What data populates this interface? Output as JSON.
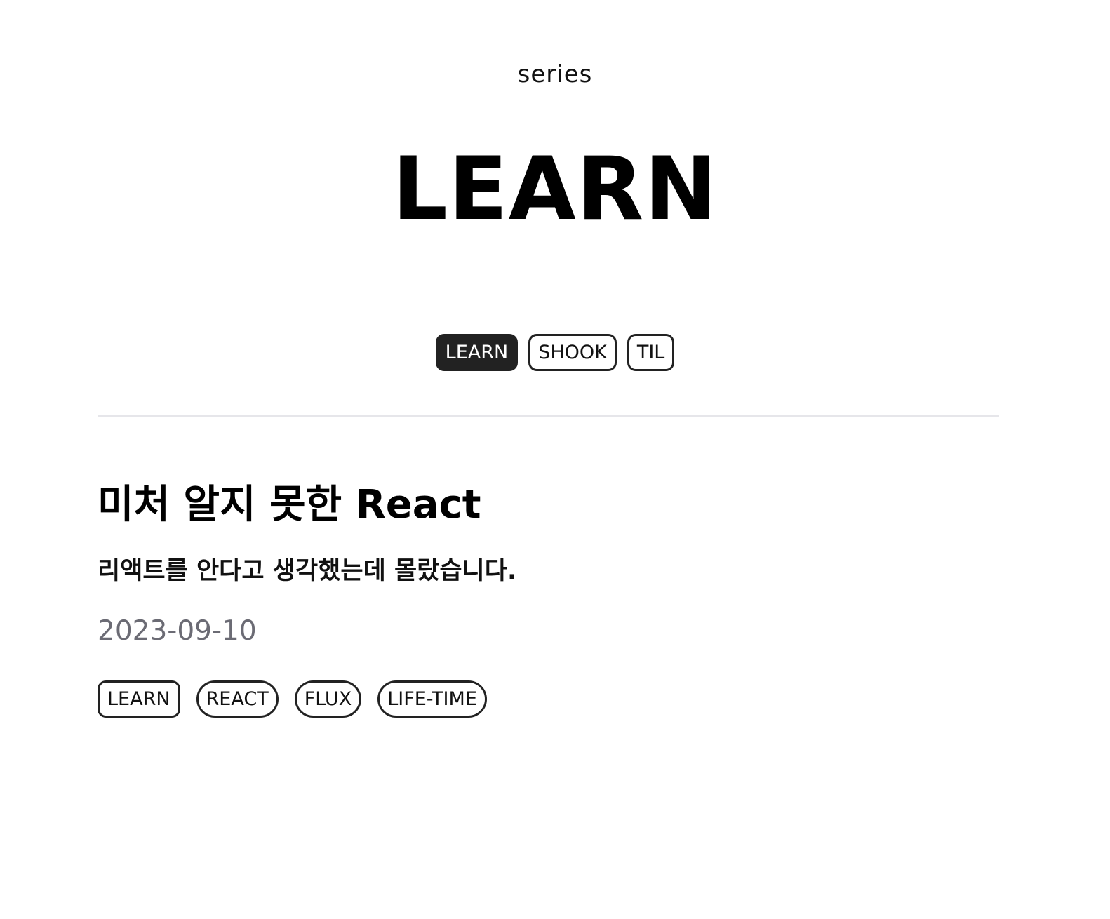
{
  "header": {
    "kicker": "series",
    "title": "LEARN"
  },
  "series_tabs": [
    {
      "label": "LEARN",
      "active": true
    },
    {
      "label": "SHOOK",
      "active": false
    },
    {
      "label": "TIL",
      "active": false
    }
  ],
  "post": {
    "title": "미처 알지 못한 React",
    "description": "리액트를 안다고 생각했는데 몰랐습니다.",
    "date": "2023-09-10",
    "tags": [
      "LEARN",
      "REACT",
      "FLUX",
      "LIFE-TIME"
    ]
  },
  "colors": {
    "active_tab_bg": "#222222",
    "date_text": "#6b6b74",
    "divider": "#e6e6ea"
  }
}
